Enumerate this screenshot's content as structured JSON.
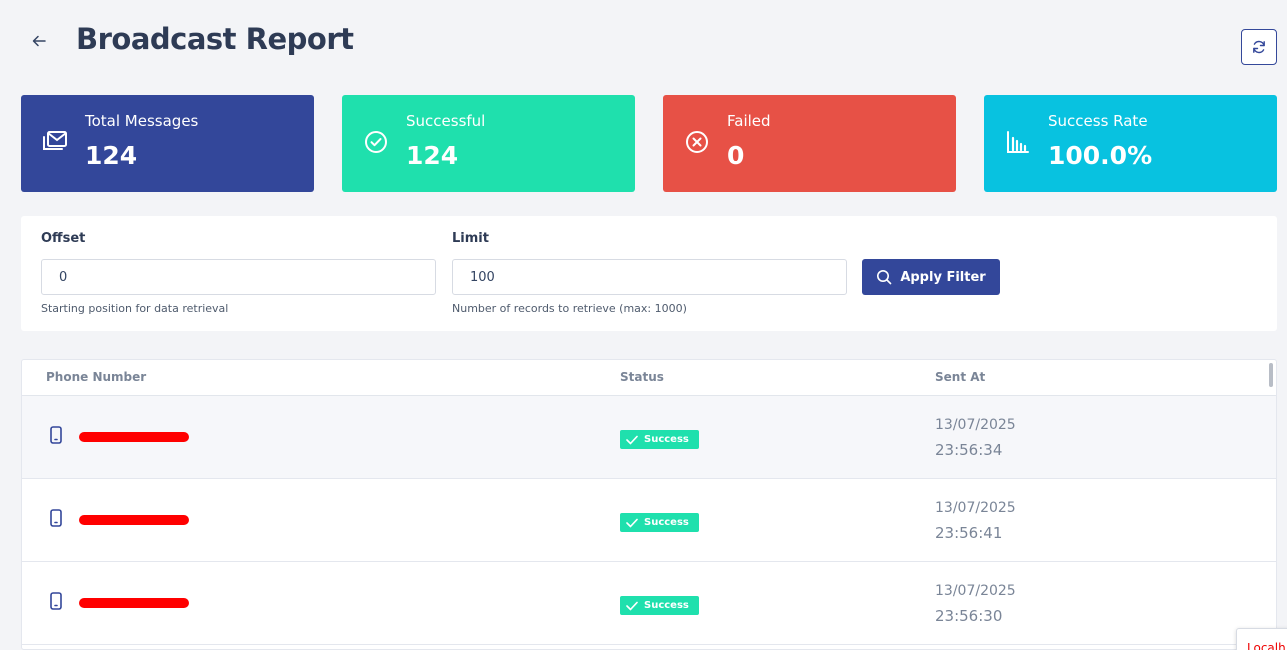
{
  "header": {
    "title": "Broadcast Report",
    "back_icon": "arrow-left-icon",
    "refresh_icon": "refresh-icon"
  },
  "stats": [
    {
      "label": "Total Messages",
      "value": "124",
      "icon": "mail-stack-icon",
      "color": "#33479a"
    },
    {
      "label": "Successful",
      "value": "124",
      "icon": "check-circle-icon",
      "color": "#1fe0ad"
    },
    {
      "label": "Failed",
      "value": "0",
      "icon": "x-circle-icon",
      "color": "#e75146"
    },
    {
      "label": "Success Rate",
      "value": "100.0%",
      "icon": "bar-chart-icon",
      "color": "#08c2e0"
    }
  ],
  "filter": {
    "offset_label": "Offset",
    "offset_value": "0",
    "offset_help": "Starting position for data retrieval",
    "limit_label": "Limit",
    "limit_value": "100",
    "limit_help": "Number of records to retrieve (max: 1000)",
    "apply_label": "Apply Filter"
  },
  "table": {
    "columns": [
      "Phone Number",
      "Status",
      "Sent At"
    ],
    "rows": [
      {
        "status": "Success",
        "date": "13/07/2025",
        "time": "23:56:34"
      },
      {
        "status": "Success",
        "date": "13/07/2025",
        "time": "23:56:41"
      },
      {
        "status": "Success",
        "date": "13/07/2025",
        "time": "23:56:30"
      }
    ]
  },
  "toast": {
    "text": "Localh"
  }
}
